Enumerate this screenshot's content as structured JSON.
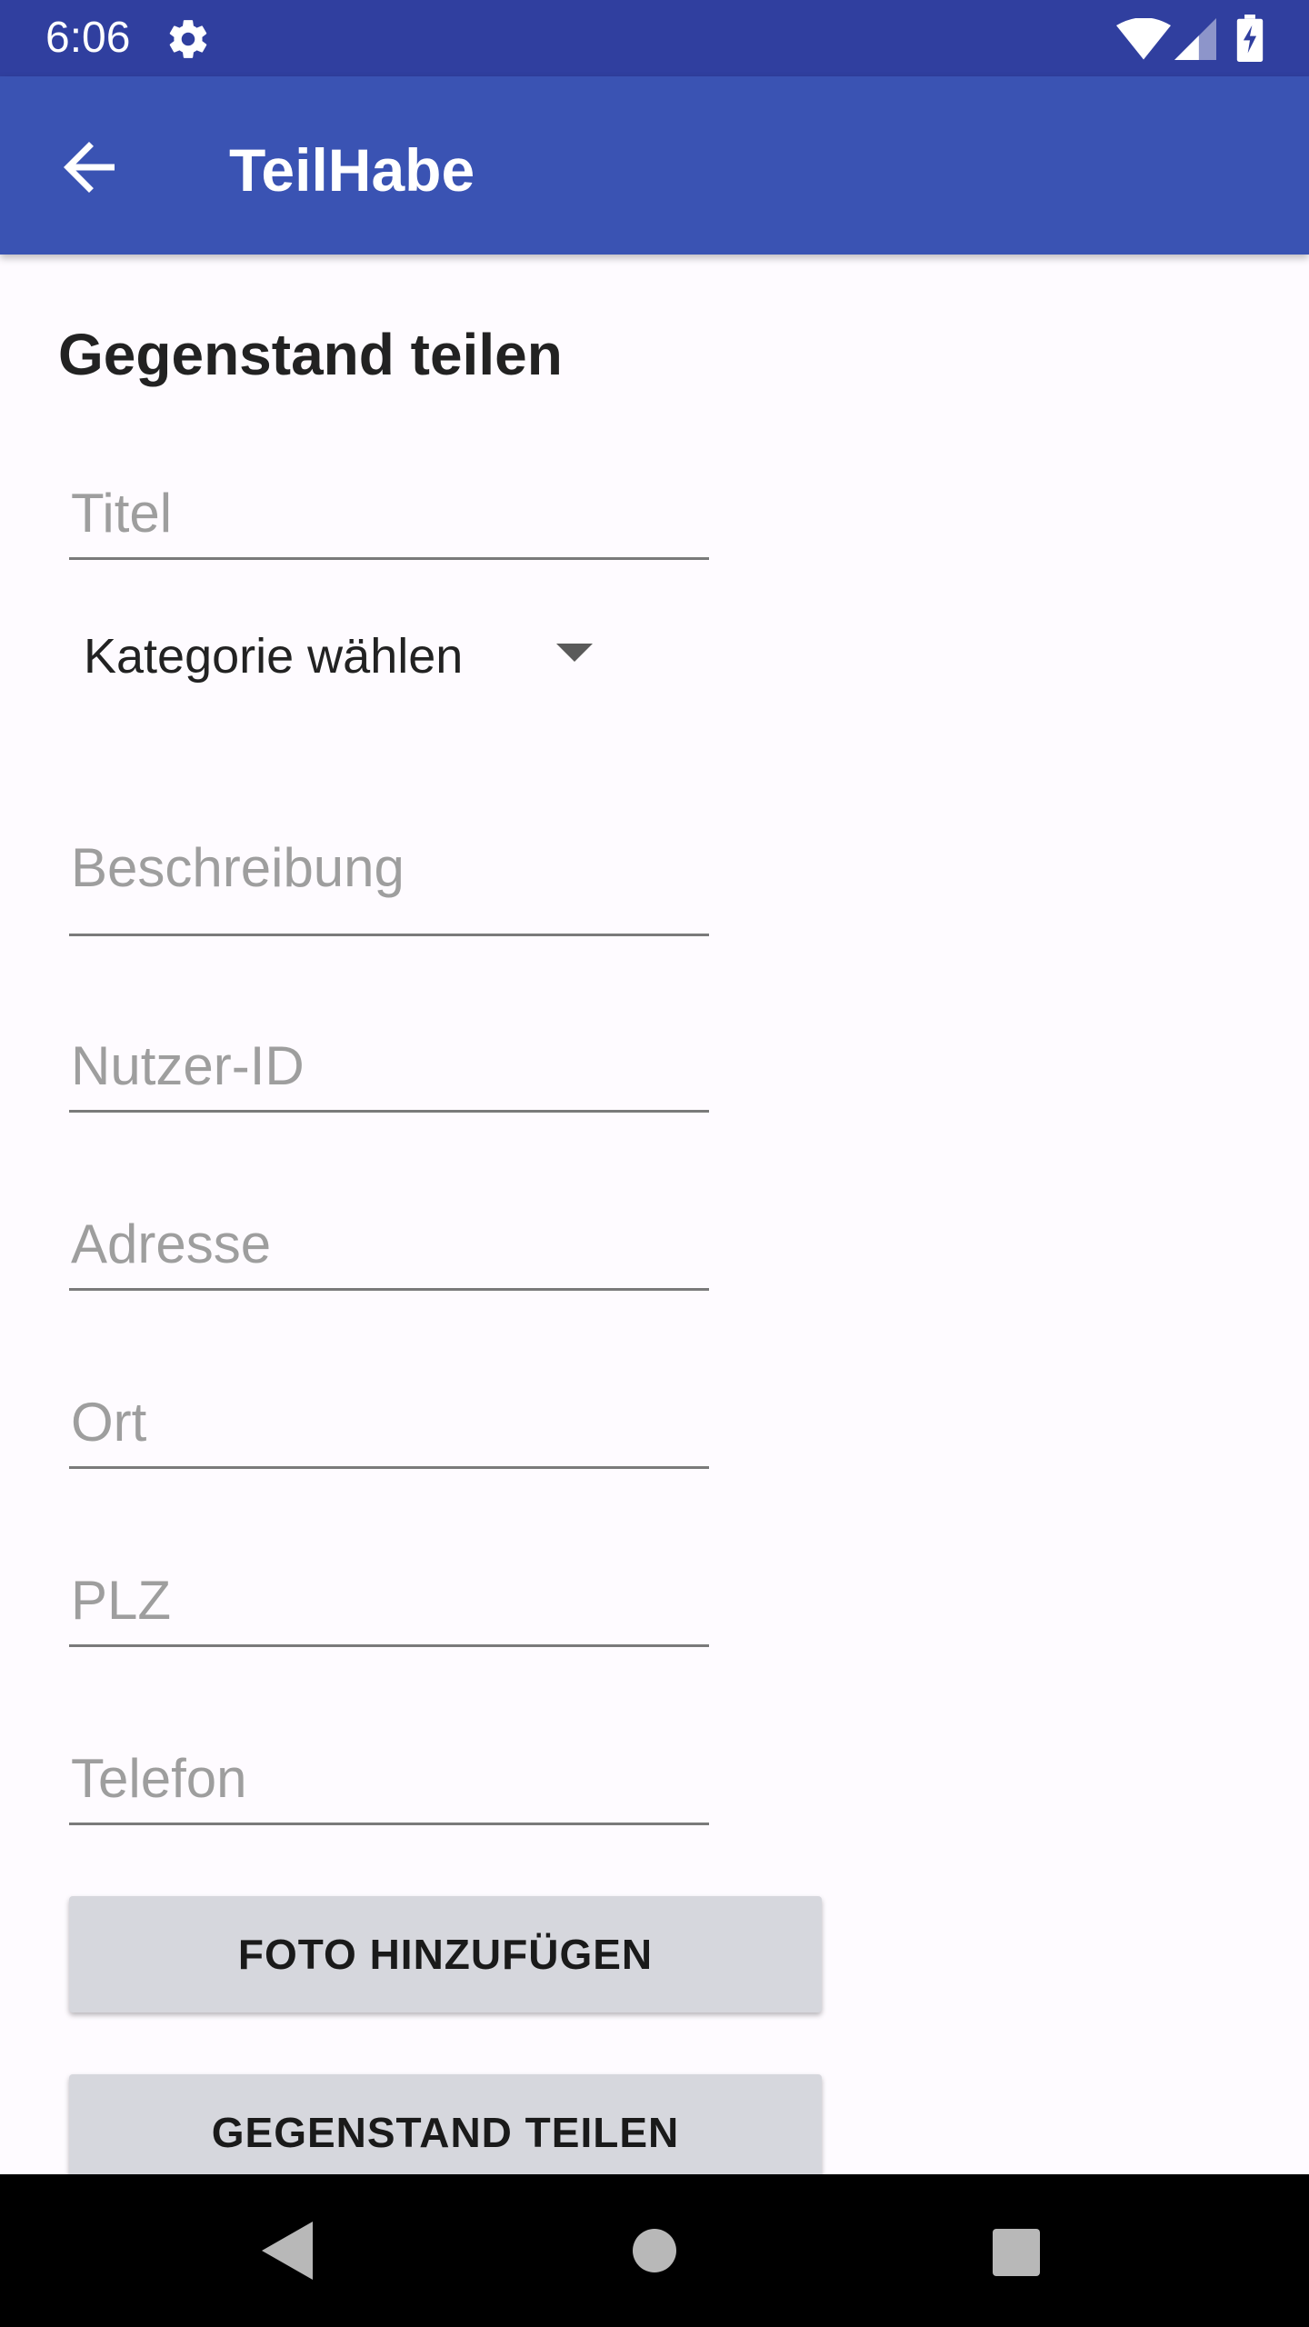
{
  "status_bar": {
    "time": "6:06",
    "icons": [
      "gear-icon",
      "wifi-icon",
      "signal-icon",
      "battery-charging-icon"
    ]
  },
  "app_bar": {
    "title": "TeilHabe",
    "back_icon": "arrow-back-icon",
    "color": "#3a53b3"
  },
  "form": {
    "heading": "Gegenstand teilen",
    "title_placeholder": "Titel",
    "category_selected": "Kategorie wählen",
    "description_placeholder": "Beschreibung",
    "user_id_placeholder": "Nutzer-ID",
    "address_placeholder": "Adresse",
    "city_placeholder": "Ort",
    "zip_placeholder": "PLZ",
    "phone_placeholder": "Telefon",
    "add_photo_label": "FOTO HINZUFÜGEN",
    "share_item_label": "GEGENSTAND TEILEN"
  },
  "nav_bar": {
    "icons": [
      "nav-back-icon",
      "nav-home-icon",
      "nav-recents-icon"
    ]
  }
}
